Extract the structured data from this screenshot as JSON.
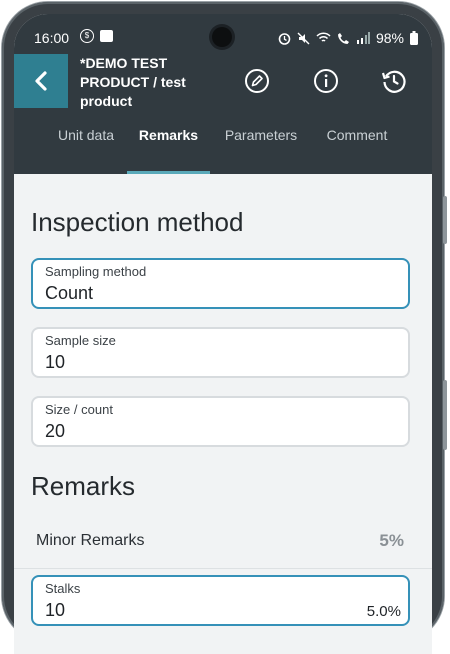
{
  "status_bar": {
    "time": "16:00",
    "battery": "98%"
  },
  "header": {
    "title": "*DEMO TEST PRODUCT / test product",
    "icons": [
      "back-arrow-icon",
      "pencil-icon",
      "info-icon",
      "history-icon"
    ]
  },
  "tabs": [
    {
      "label": "Unit data",
      "active": false
    },
    {
      "label": "Remarks",
      "active": true
    },
    {
      "label": "Parameters",
      "active": false
    },
    {
      "label": "Comment",
      "active": false
    }
  ],
  "inspection": {
    "heading": "Inspection method",
    "fields": [
      {
        "label": "Sampling method",
        "value": "Count"
      },
      {
        "label": "Sample size",
        "value": "10"
      },
      {
        "label": "Size / count",
        "value": "20"
      }
    ]
  },
  "remarks": {
    "heading": "Remarks",
    "minor_label": "Minor Remarks",
    "minor_pct": "5%",
    "stalks": {
      "label": "Stalks",
      "value": "10",
      "pct": "5.0%"
    }
  },
  "colors": {
    "header_bg": "#313a40",
    "accent": "#2f7f91",
    "focus": "#3591b8"
  }
}
